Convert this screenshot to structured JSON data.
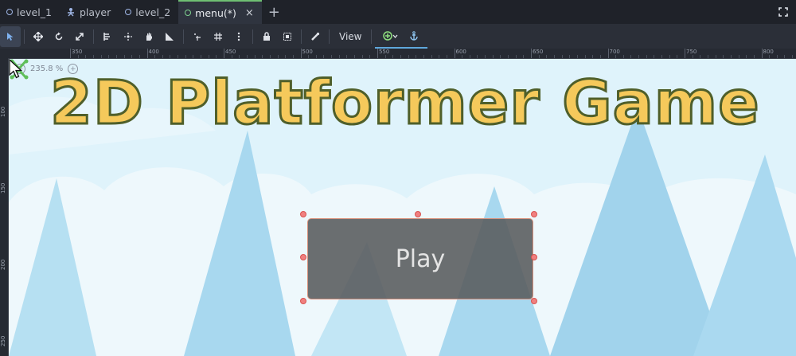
{
  "tabs": [
    {
      "label": "level_1",
      "icon": "scene-circle-icon",
      "active": false
    },
    {
      "label": "player",
      "icon": "player-node-icon",
      "active": false
    },
    {
      "label": "level_2",
      "icon": "scene-circle-icon",
      "active": false
    },
    {
      "label": "menu(*)",
      "icon": "scene-circle-icon",
      "active": true
    }
  ],
  "tab_close": "×",
  "tab_add": "+",
  "toolbar": {
    "view_label": "View",
    "icons": [
      "select-icon",
      "move-icon",
      "rotate-icon",
      "scale-icon",
      "list-icon",
      "pivot-icon",
      "pan-icon",
      "ruler-icon",
      "snap-icon",
      "grid-snap-icon",
      "more-icon",
      "lock-icon",
      "group-icon",
      "bone-icon",
      "add-anchor-icon",
      "anchor-icon"
    ]
  },
  "ruler": {
    "labels": [
      "350",
      "400",
      "450",
      "500",
      "550",
      "600",
      "650",
      "700",
      "750",
      "800"
    ],
    "v_labels": [
      "100",
      "150",
      "200",
      "250"
    ]
  },
  "canvas": {
    "zoom_label": "235.8 %",
    "title": "2D Platformer Game",
    "button_label": "Play"
  },
  "colors": {
    "title_fill": "#f5c95b",
    "title_outline": "#4f5f2a",
    "sky": "#dff3fb",
    "tree": "#a8d8ef",
    "button_bg": "#5a5c5e",
    "selection": "#d9534f",
    "active_tab_accent": "#6fbf73"
  }
}
